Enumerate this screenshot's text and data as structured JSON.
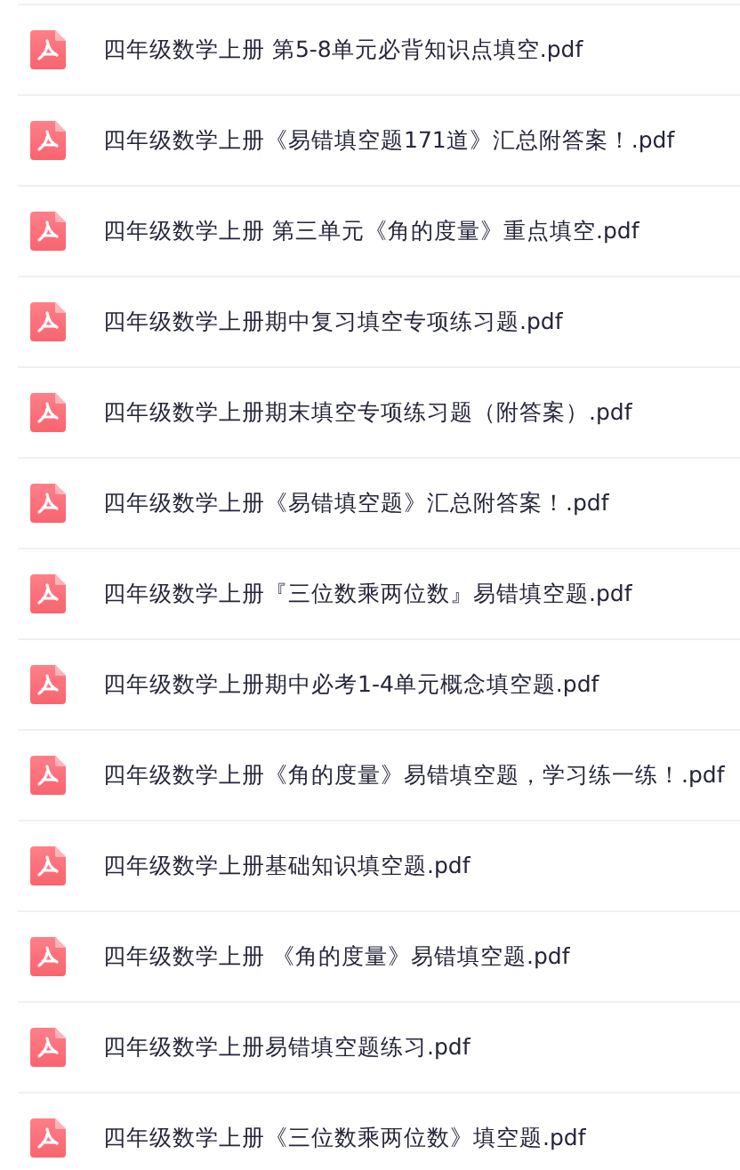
{
  "files": [
    {
      "name": "四年级数学上册 第5-8单元必背知识点填空.pdf"
    },
    {
      "name": "四年级数学上册《易错填空题171道》汇总附答案！.pdf"
    },
    {
      "name": "四年级数学上册 第三单元《角的度量》重点填空.pdf"
    },
    {
      "name": "四年级数学上册期中复习填空专项练习题.pdf"
    },
    {
      "name": "四年级数学上册期末填空专项练习题（附答案）.pdf"
    },
    {
      "name": "四年级数学上册《易错填空题》汇总附答案！.pdf"
    },
    {
      "name": "四年级数学上册『三位数乘两位数』易错填空题.pdf"
    },
    {
      "name": "四年级数学上册期中必考1-4单元概念填空题.pdf"
    },
    {
      "name": "四年级数学上册《角的度量》易错填空题，学习练一练！.pdf"
    },
    {
      "name": "四年级数学上册基础知识填空题.pdf"
    },
    {
      "name": "四年级数学上册 《角的度量》易错填空题.pdf"
    },
    {
      "name": "四年级数学上册易错填空题练习.pdf"
    },
    {
      "name": "四年级数学上册《三位数乘两位数》填空题.pdf"
    }
  ]
}
